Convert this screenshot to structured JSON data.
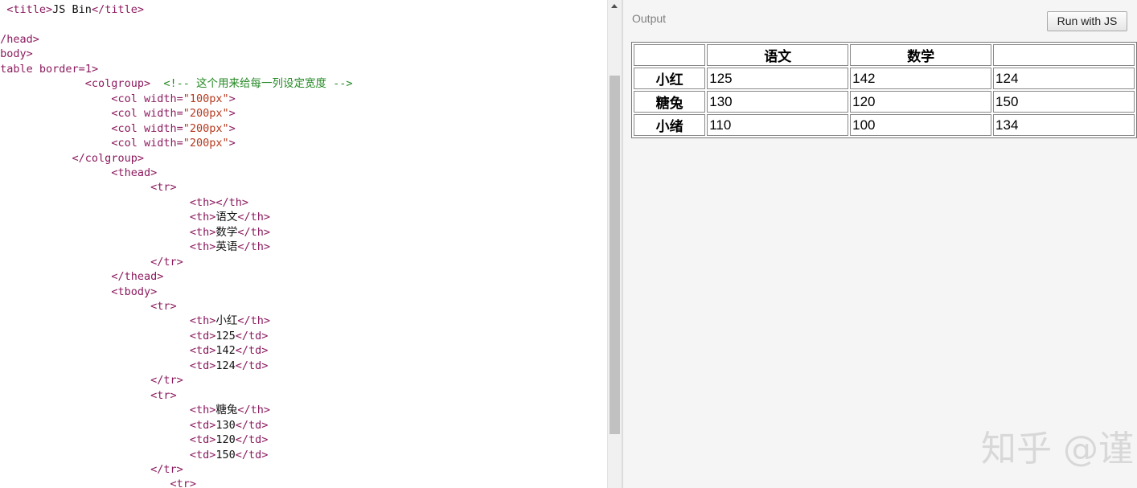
{
  "editor": {
    "lines": [
      {
        "indent": "  ",
        "parts": [
          [
            "tag",
            "<title>"
          ],
          [
            "txt",
            "JS Bin"
          ],
          [
            "tag",
            "</title>"
          ]
        ]
      },
      {
        "indent": "",
        "parts": []
      },
      {
        "indent": "",
        "parts": [
          [
            "tag",
            "</head>"
          ]
        ]
      },
      {
        "indent": "",
        "parts": [
          [
            "tag",
            "<body>"
          ]
        ]
      },
      {
        "indent": "",
        "parts": [
          [
            "tag",
            "<table "
          ],
          [
            "attr",
            "border="
          ],
          [
            "val",
            "1"
          ],
          [
            "tag",
            ">"
          ]
        ]
      },
      {
        "indent": "              ",
        "parts": [
          [
            "tag",
            "<colgroup>"
          ],
          [
            "cmt",
            "  <!-- 这个用来给每一列设定宽度 -->"
          ]
        ]
      },
      {
        "indent": "                  ",
        "parts": [
          [
            "tag",
            "<col "
          ],
          [
            "attr",
            "width="
          ],
          [
            "str",
            "\"100px\""
          ],
          [
            "tag",
            ">"
          ]
        ]
      },
      {
        "indent": "                  ",
        "parts": [
          [
            "tag",
            "<col "
          ],
          [
            "attr",
            "width="
          ],
          [
            "str",
            "\"200px\""
          ],
          [
            "tag",
            ">"
          ]
        ]
      },
      {
        "indent": "                  ",
        "parts": [
          [
            "tag",
            "<col "
          ],
          [
            "attr",
            "width="
          ],
          [
            "str",
            "\"200px\""
          ],
          [
            "tag",
            ">"
          ]
        ]
      },
      {
        "indent": "                  ",
        "parts": [
          [
            "tag",
            "<col "
          ],
          [
            "attr",
            "width="
          ],
          [
            "str",
            "\"200px\""
          ],
          [
            "tag",
            ">"
          ]
        ]
      },
      {
        "indent": "            ",
        "parts": [
          [
            "tag",
            "</colgroup>"
          ]
        ]
      },
      {
        "indent": "                  ",
        "parts": [
          [
            "tag",
            "<thead>"
          ]
        ]
      },
      {
        "indent": "                        ",
        "parts": [
          [
            "tag",
            "<tr>"
          ]
        ]
      },
      {
        "indent": "                              ",
        "parts": [
          [
            "tag",
            "<th></th>"
          ]
        ]
      },
      {
        "indent": "                              ",
        "parts": [
          [
            "tag",
            "<th>"
          ],
          [
            "txt",
            "语文"
          ],
          [
            "tag",
            "</th>"
          ]
        ]
      },
      {
        "indent": "                              ",
        "parts": [
          [
            "tag",
            "<th>"
          ],
          [
            "txt",
            "数学"
          ],
          [
            "tag",
            "</th>"
          ]
        ]
      },
      {
        "indent": "                              ",
        "parts": [
          [
            "tag",
            "<th>"
          ],
          [
            "txt",
            "英语"
          ],
          [
            "tag",
            "</th>"
          ]
        ]
      },
      {
        "indent": "                        ",
        "parts": [
          [
            "tag",
            "</tr>"
          ]
        ]
      },
      {
        "indent": "                  ",
        "parts": [
          [
            "tag",
            "</thead>"
          ]
        ]
      },
      {
        "indent": "                  ",
        "parts": [
          [
            "tag",
            "<tbody>"
          ]
        ]
      },
      {
        "indent": "                        ",
        "parts": [
          [
            "tag",
            "<tr>"
          ]
        ]
      },
      {
        "indent": "                              ",
        "parts": [
          [
            "tag",
            "<th>"
          ],
          [
            "txt",
            "小红"
          ],
          [
            "tag",
            "</th>"
          ]
        ]
      },
      {
        "indent": "                              ",
        "parts": [
          [
            "tag",
            "<td>"
          ],
          [
            "txt",
            "125"
          ],
          [
            "tag",
            "</td>"
          ]
        ]
      },
      {
        "indent": "                              ",
        "parts": [
          [
            "tag",
            "<td>"
          ],
          [
            "txt",
            "142"
          ],
          [
            "tag",
            "</td>"
          ]
        ]
      },
      {
        "indent": "                              ",
        "parts": [
          [
            "tag",
            "<td>"
          ],
          [
            "txt",
            "124"
          ],
          [
            "tag",
            "</td>"
          ]
        ]
      },
      {
        "indent": "                        ",
        "parts": [
          [
            "tag",
            "</tr>"
          ]
        ]
      },
      {
        "indent": "                        ",
        "parts": [
          [
            "tag",
            "<tr>"
          ]
        ]
      },
      {
        "indent": "                              ",
        "parts": [
          [
            "tag",
            "<th>"
          ],
          [
            "txt",
            "糖兔"
          ],
          [
            "tag",
            "</th>"
          ]
        ]
      },
      {
        "indent": "                              ",
        "parts": [
          [
            "tag",
            "<td>"
          ],
          [
            "txt",
            "130"
          ],
          [
            "tag",
            "</td>"
          ]
        ]
      },
      {
        "indent": "                              ",
        "parts": [
          [
            "tag",
            "<td>"
          ],
          [
            "txt",
            "120"
          ],
          [
            "tag",
            "</td>"
          ]
        ]
      },
      {
        "indent": "                              ",
        "parts": [
          [
            "tag",
            "<td>"
          ],
          [
            "txt",
            "150"
          ],
          [
            "tag",
            "</td>"
          ]
        ]
      },
      {
        "indent": "                        ",
        "parts": [
          [
            "tag",
            "</tr>"
          ]
        ]
      },
      {
        "indent": "                           ",
        "parts": [
          [
            "tag",
            "<tr>"
          ]
        ]
      }
    ]
  },
  "output": {
    "label": "Output",
    "run_button": "Run with JS",
    "table": {
      "headers": [
        "",
        "语文",
        "数学",
        ""
      ],
      "rows": [
        {
          "name": "小红",
          "values": [
            "125",
            "142",
            "124"
          ]
        },
        {
          "name": "糖兔",
          "values": [
            "130",
            "120",
            "150"
          ]
        },
        {
          "name": "小绪",
          "values": [
            "110",
            "100",
            "134"
          ]
        }
      ]
    },
    "watermark": "知乎 @谨"
  }
}
